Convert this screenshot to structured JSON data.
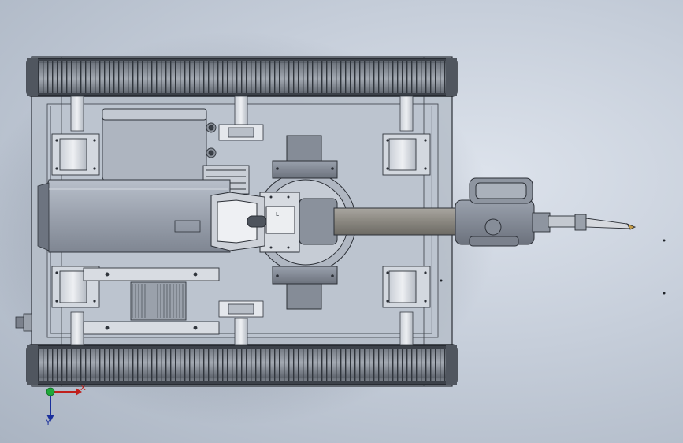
{
  "window": {
    "title": ""
  },
  "viewport": {
    "background_top": "#dde3ec",
    "background_bottom": "#aab4c2"
  },
  "model": {
    "assembly_description": "",
    "colors": {
      "frame_outline": "#2b2f36",
      "frame_fill": "#b7bfcb",
      "track": "#8a9099",
      "track_dark": "#3c4149",
      "tank": "#9ca3ae",
      "arm": "#8e8f8b",
      "joint": "#7b818c"
    },
    "small_marker_text": "L"
  },
  "triad": {
    "x_label": "X",
    "y_label": "Y",
    "x_color": "#c0201c",
    "y_color": "#1a2f9c",
    "origin_color": "#1fa83a"
  }
}
